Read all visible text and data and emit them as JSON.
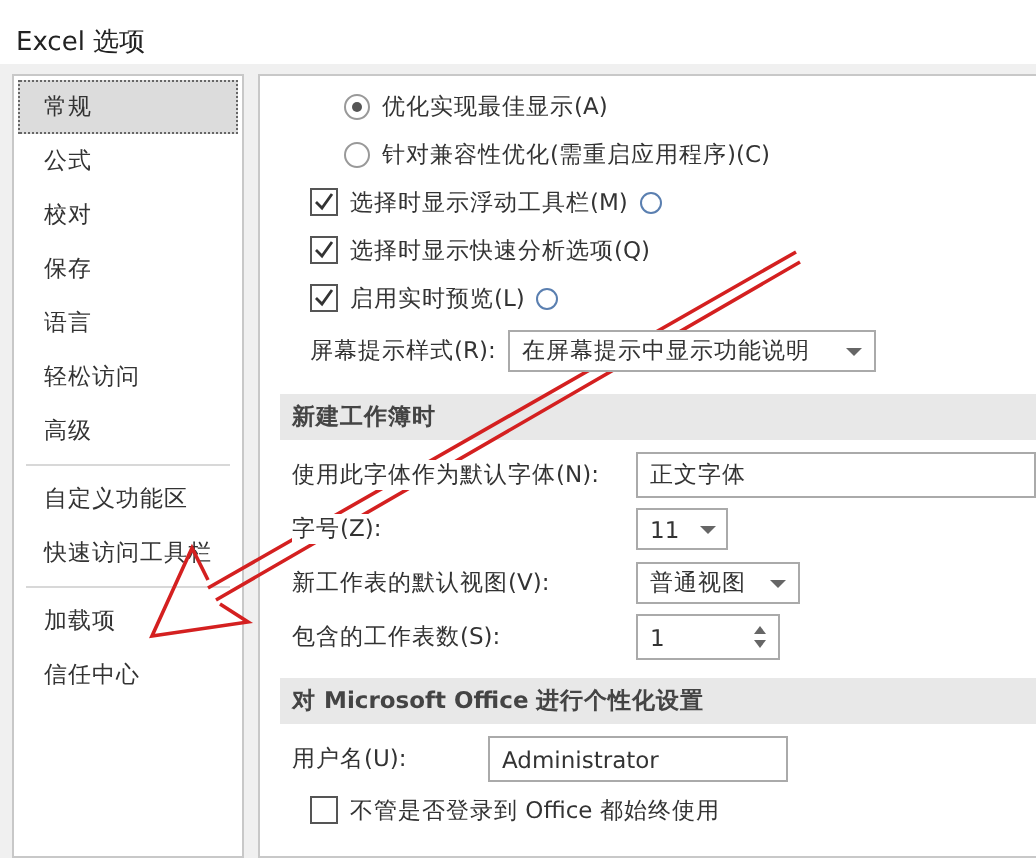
{
  "window": {
    "title": "Excel 选项"
  },
  "sidebar": {
    "groups": [
      {
        "items": [
          {
            "label": "常规",
            "selected": true
          },
          {
            "label": "公式",
            "selected": false
          },
          {
            "label": "校对",
            "selected": false
          },
          {
            "label": "保存",
            "selected": false
          },
          {
            "label": "语言",
            "selected": false
          },
          {
            "label": "轻松访问",
            "selected": false
          },
          {
            "label": "高级",
            "selected": false
          }
        ]
      },
      {
        "items": [
          {
            "label": "自定义功能区",
            "selected": false
          },
          {
            "label": "快速访问工具栏",
            "selected": false
          }
        ]
      },
      {
        "items": [
          {
            "label": "加载项",
            "selected": false
          },
          {
            "label": "信任中心",
            "selected": false
          }
        ]
      }
    ]
  },
  "options": [
    {
      "kind": "radio",
      "label": "优化实现最佳显示(A)",
      "selected": true,
      "info": false
    },
    {
      "kind": "radio",
      "label": "针对兼容性优化(需重启应用程序)(C)",
      "selected": false,
      "info": false
    },
    {
      "kind": "checkbox",
      "label": "选择时显示浮动工具栏(M)",
      "checked": true,
      "info": true
    },
    {
      "kind": "checkbox",
      "label": "选择时显示快速分析选项(Q)",
      "checked": true,
      "info": false
    },
    {
      "kind": "checkbox",
      "label": "启用实时预览(L)",
      "checked": true,
      "info": true
    },
    {
      "kind": "select",
      "label": "屏幕提示样式(R):",
      "value": "在屏幕提示中显示功能说明"
    }
  ],
  "new_workbook": {
    "heading": "新建工作簿时",
    "fields": [
      {
        "kind": "text",
        "label": "使用此字体作为默认字体(N):",
        "value": "正文字体"
      },
      {
        "kind": "select",
        "label": "字号(Z):",
        "value": "11"
      },
      {
        "kind": "select",
        "label": "新工作表的默认视图(V):",
        "value": "普通视图"
      },
      {
        "kind": "spin",
        "label": "包含的工作表数(S):",
        "value": "1"
      }
    ]
  },
  "personalize": {
    "heading": "对 Microsoft Office 进行个性化设置",
    "username_label": "用户名(U):",
    "username": "Administrator",
    "always_use": {
      "label": "不管是否登录到 Office 都始终使用",
      "checked": false
    }
  }
}
